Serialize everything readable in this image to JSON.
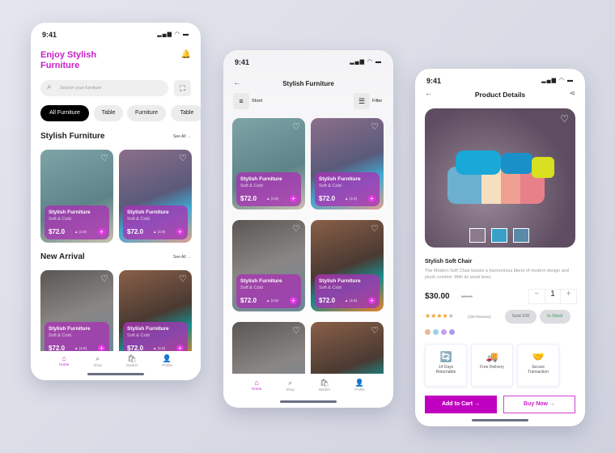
{
  "colors": {
    "accent": "#c81ec8",
    "overlay": "#a832b4"
  },
  "status": {
    "time": "9:41",
    "icons": "▂▄▆ ◠ ▬"
  },
  "home": {
    "title": "Enjoy Stylish Furniture",
    "search_placeholder": "Search your furniture",
    "chips": [
      "All Furniture",
      "Table",
      "Furniture",
      "Table"
    ],
    "section1": "Stylish Furniture",
    "section2": "New Arrival",
    "see_all": "See All →"
  },
  "card": {
    "name": "Stylish Furniture",
    "sub": "Soft & Cold",
    "price": "$72.0",
    "rating": "▲ (4.9)"
  },
  "nav": [
    {
      "label": "Home",
      "icon": "⌂"
    },
    {
      "label": "Shop",
      "icon": "⌕"
    },
    {
      "label": "Basket",
      "icon": "🛍"
    },
    {
      "label": "Profile",
      "icon": "👤"
    }
  ],
  "list": {
    "title": "Stylish Furniture",
    "sort": "Short",
    "filter": "Filter"
  },
  "detail": {
    "title": "Product  Details",
    "name": "Stylish Soft Chair",
    "description": "The Modern Soft Chair boasts a harmonious blend of modern design and plush comfort. With its sleek lines,",
    "price": "$30.00",
    "old_price": "$40.00",
    "quantity": "1",
    "rating_stars": 4,
    "reviews": "(150 Reviews)",
    "sold": "Sold 100",
    "stock": "In Stock",
    "swatches": [
      "#e8b79a",
      "#9fd0ee",
      "#c8a0ee",
      "#a89cf0"
    ],
    "features": [
      {
        "label": "14 Days Returnable",
        "icon": "🔄"
      },
      {
        "label": "Free Delivery",
        "icon": "🚚"
      },
      {
        "label": "Secure Transaction",
        "icon": "🤝"
      }
    ],
    "add_to_cart": "Add to Cart  →",
    "buy_now": "Buy Now  →"
  }
}
